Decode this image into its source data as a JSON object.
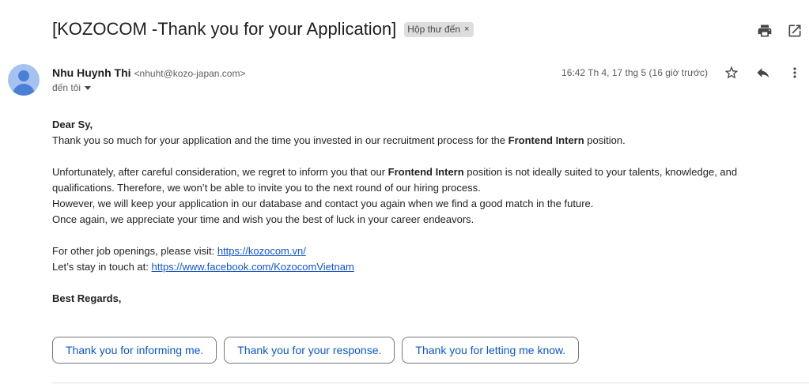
{
  "email": {
    "subject": "[KOZOCOM -Thank you for your Application]",
    "label": "Hộp thư đến",
    "label_remove": "×",
    "sender_name": "Nhu Huynh Thi",
    "sender_email": "<nhuht@kozo-japan.com>",
    "to_label": "đến tôi",
    "timestamp": "16:42 Th 4, 17 thg 5 (16 giờ trước)"
  },
  "body": {
    "greeting": "Dear Sy,",
    "p1_start": "Thank you so much for your application and the time you invested in our recruitment process for the ",
    "position": "Frontend Intern",
    "p1_end": " position.",
    "p2_start": "Unfortunately, after careful consideration, we regret to inform you that our ",
    "p2_end": " position is not ideally suited to your talents, knowledge, and",
    "p2_line2": "qualifications. Therefore, we won’t be able to invite you to the next round of our hiring process.",
    "p3": "However, we will keep your application in our database and contact you again when we find a good match in the future.",
    "p4": "Once again, we appreciate your time and wish you the best of luck in your career endeavors.",
    "jobs_prefix": "For other job openings, please visit: ",
    "jobs_link": "https://kozocom.vn/",
    "social_prefix": "Let’s stay in touch at: ",
    "social_link": "https://www.facebook.com/KozocomVietnam",
    "closing": "Best Regards,"
  },
  "smart_replies": [
    "Thank you for informing me.",
    "Thank you for your response.",
    "Thank you for letting me know."
  ],
  "icons": {
    "print": "print-icon",
    "open_new_window": "open-in-new-icon",
    "star": "star-icon",
    "reply": "reply-icon",
    "more": "more-vert-icon"
  },
  "colors": {
    "link": "#1155cc",
    "reply_chip_text": "#0b57d0",
    "avatar_bg": "#a6c3f0",
    "avatar_fg": "#4a7fd6",
    "label_bg": "#dddddd"
  }
}
